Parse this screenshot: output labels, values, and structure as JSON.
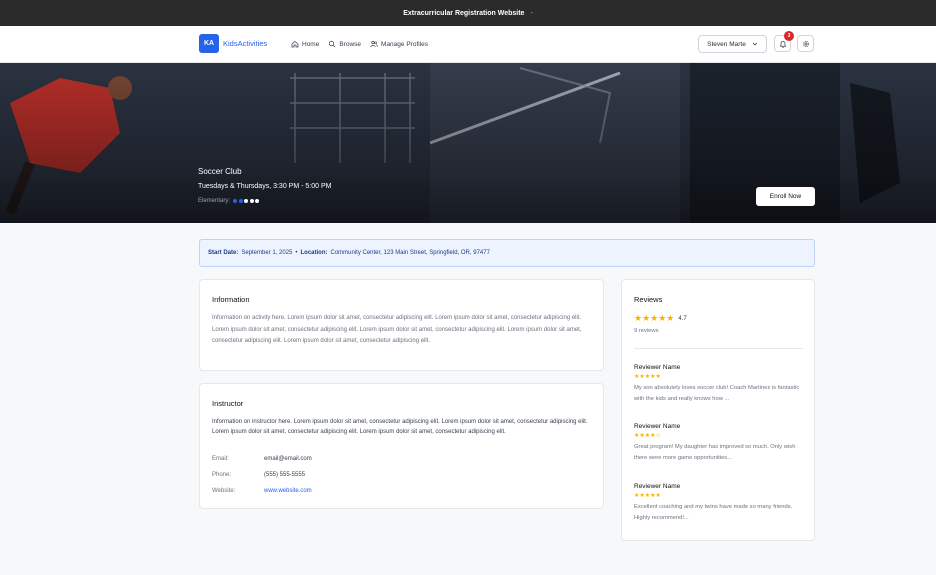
{
  "topbar": {
    "title": "Extracurricular Registration Website",
    "suffix": "-"
  },
  "nav": {
    "logo_initials": "KA",
    "logo_text": "KidsActivities",
    "links": [
      {
        "label": "Home",
        "icon": "home-icon"
      },
      {
        "label": "Browse",
        "icon": "search-icon"
      },
      {
        "label": "Manage Profiles",
        "icon": "users-icon"
      }
    ],
    "user_name": "Steven Marte",
    "notification_count": "3"
  },
  "hero": {
    "title": "Soccer Club",
    "schedule": "Tuesdays & Thursdays, 3:30 PM - 5:00 PM",
    "level_label": "Elementary:",
    "level_dots_filled": 2,
    "level_dots_total": 5,
    "enroll_label": "Enroll Now"
  },
  "banner": {
    "start_label": "Start Date:",
    "start_value": "September 1, 2025",
    "separator": "•",
    "location_label": "Location:",
    "location_value": "Community Center, 123 Main Street, Springfield, OR, 97477"
  },
  "information": {
    "title": "Information",
    "text": "Information on activity here. Lorem ipsum dolor sit amet, consectetur adipiscing elit. Lorem ipsum dolor sit amet, consectetur adipiscing elit. Lorem ipsum dolor sit amet, consectetur adipiscing elit. Lorem ipsum dolor sit amet, consectetur adipiscing elit. Lorem ipsum dolor sit amet, consectetur adipiscing elit. Lorem ipsum dolor sit amet, consectetur adipiscing elit."
  },
  "instructor": {
    "title": "Instructor",
    "text": "Information on instructor here. Lorem ipsum dolor sit amet, consectetur adipiscing elit. Lorem ipsum dolor sit amet, consectetur adipiscing elit. Lorem ipsum dolor sit amet, consectetur adipiscing elit. Lorem ipsum dolor sit amet, consectetur adipiscing elit.",
    "email_label": "Email:",
    "email_value": "email@email.com",
    "phone_label": "Phone:",
    "phone_value": "(555) 555-5555",
    "website_label": "Website:",
    "website_value": "www.website.com"
  },
  "reviews": {
    "title": "Reviews",
    "rating": "4.7",
    "rating_stars": "★★★★★",
    "count_label": "9 reviews",
    "items": [
      {
        "name": "Reviewer Name",
        "stars": "★★★★★",
        "text": "My son absolutely loves soccer club! Coach Martinez is fantastic with the kids and really knows how ..."
      },
      {
        "name": "Reviewer Name",
        "stars": "★★★★☆",
        "text": "Great program! My daughter has improved so much. Only wish there were more game opportunities..."
      },
      {
        "name": "Reviewer Name",
        "stars": "★★★★★",
        "text": "Excellent coaching and my twins have made so many friends. Highly recommend!..."
      }
    ]
  },
  "colors": {
    "accent": "#2563eb",
    "star": "#f5b301",
    "badge": "#dc2626"
  }
}
